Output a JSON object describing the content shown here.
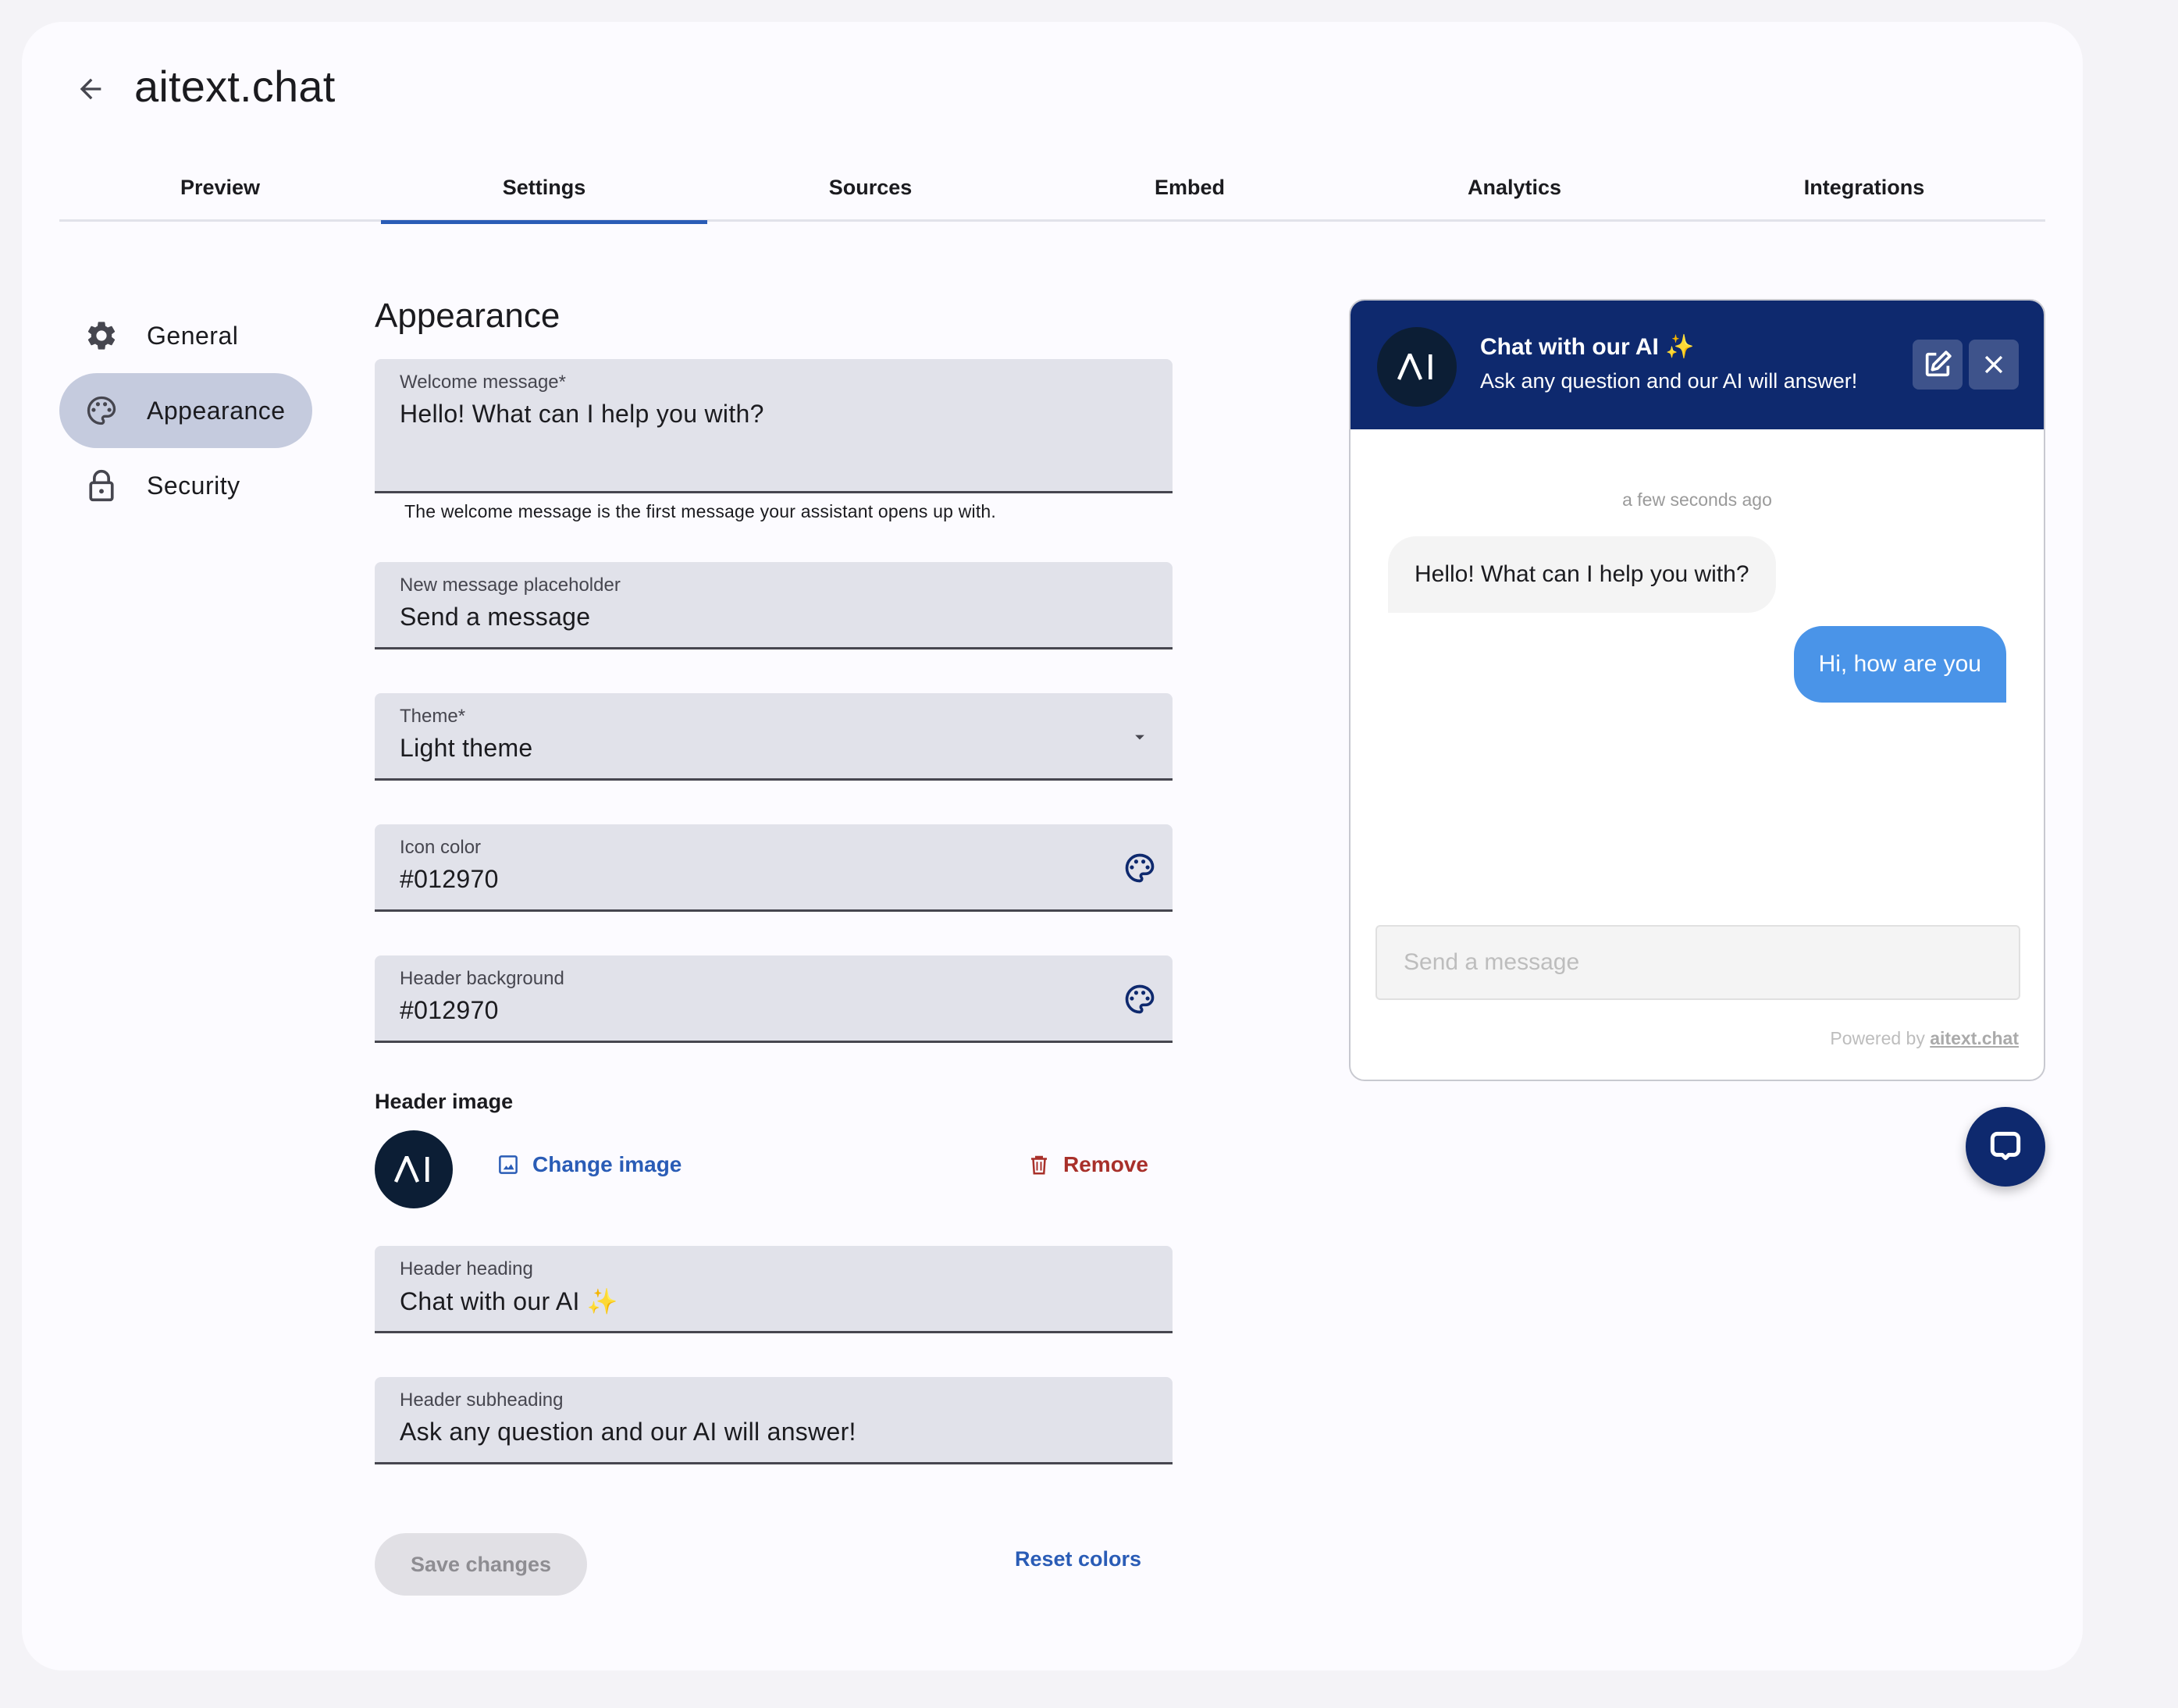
{
  "header": {
    "back_icon": "arrow-back-icon",
    "title": "aitext.chat"
  },
  "tabs": [
    {
      "label": "Preview",
      "active": false
    },
    {
      "label": "Settings",
      "active": true
    },
    {
      "label": "Sources",
      "active": false
    },
    {
      "label": "Embed",
      "active": false
    },
    {
      "label": "Analytics",
      "active": false
    },
    {
      "label": "Integrations",
      "active": false
    }
  ],
  "sidebar": {
    "items": [
      {
        "label": "General",
        "icon": "gear-icon",
        "active": false
      },
      {
        "label": "Appearance",
        "icon": "palette-icon",
        "active": true
      },
      {
        "label": "Security",
        "icon": "lock-icon",
        "active": false
      }
    ]
  },
  "form": {
    "section_title": "Appearance",
    "welcome_message": {
      "label": "Welcome message*",
      "value": "Hello! What can I help you with?",
      "helper": "The welcome message is the first message your assistant opens up with."
    },
    "placeholder": {
      "label": "New message placeholder",
      "value": "Send a message"
    },
    "theme": {
      "label": "Theme*",
      "value": "Light theme",
      "icon": "dropdown-arrow-icon"
    },
    "icon_color": {
      "label": "Icon color",
      "value": "#012970",
      "icon": "palette-icon"
    },
    "header_background": {
      "label": "Header background",
      "value": "#012970",
      "icon": "palette-icon"
    },
    "header_image": {
      "label": "Header image",
      "avatar_text": "ΛI",
      "change_label": "Change image",
      "change_icon": "image-icon",
      "remove_label": "Remove",
      "remove_icon": "trash-icon"
    },
    "header_heading": {
      "label": "Header heading",
      "value": "Chat with our AI ✨"
    },
    "header_subheading": {
      "label": "Header subheading",
      "value": "Ask any question and our AI will answer!"
    },
    "save_label": "Save changes",
    "reset_label": "Reset colors"
  },
  "chat_preview": {
    "avatar_text": "ΛI",
    "title": "Chat with our AI ✨",
    "subtitle": "Ask any question and our AI will answer!",
    "edit_icon": "edit-icon",
    "close_icon": "close-icon",
    "timestamp": "a few seconds ago",
    "messages": [
      {
        "role": "bot",
        "text": "Hello! What can I help you with?"
      },
      {
        "role": "user",
        "text": "Hi, how are you"
      }
    ],
    "input_placeholder": "Send a message",
    "powered_by_prefix": "Powered by ",
    "powered_by_link": "aitext.chat",
    "launcher_icon": "chat-bubble-icon"
  },
  "colors": {
    "accent": "#2a5cb6",
    "header_bg": "#012970",
    "danger": "#a8302a",
    "user_bubble": "#4a94e8"
  }
}
